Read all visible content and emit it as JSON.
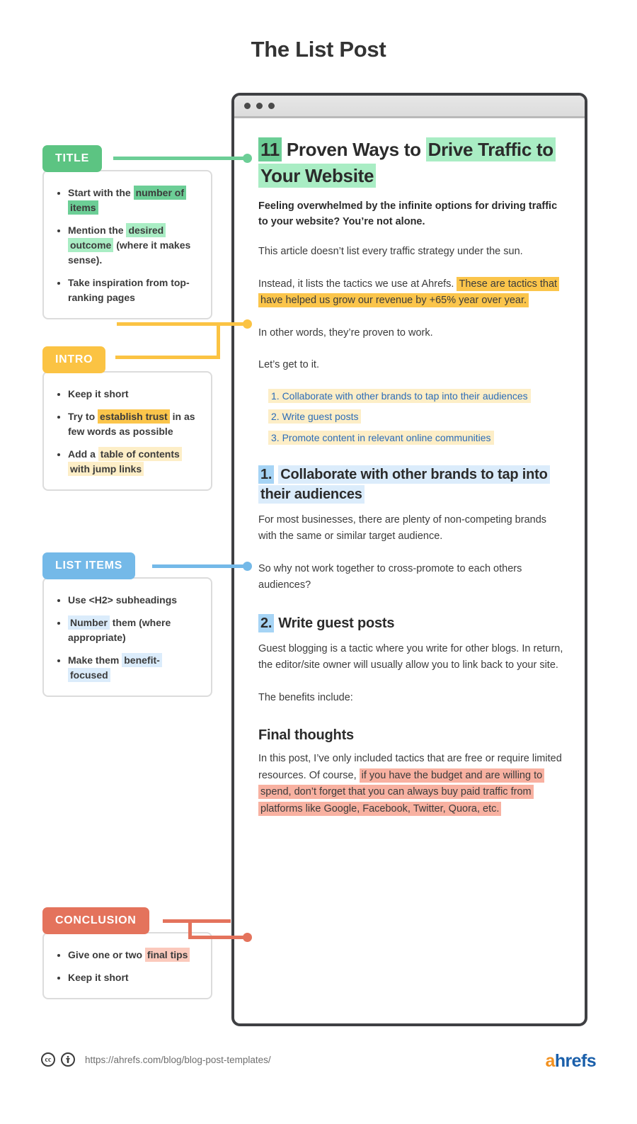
{
  "page": {
    "title": "The List Post"
  },
  "browser": {
    "dots_count": 3
  },
  "article": {
    "h1": {
      "number": "11",
      "mid": " Proven Ways to ",
      "highlight": "Drive Traffic to Your Website"
    },
    "lead": "Feeling overwhelmed by the infinite options for driving traffic to your website? You’re not alone.",
    "p1": "This article doesn’t list every traffic strategy under the sun.",
    "p2_plain": "Instead, it lists the tactics we use at Ahrefs. ",
    "p2_highlight": "These are tactics that have helped us grow our revenue by +65% year over year.",
    "p3": "In other words, they’re proven to work.",
    "p4": "Let’s get to it.",
    "toc": [
      "1. Collaborate with other brands to tap into their audiences",
      "2. Write guest posts",
      "3. Promote content in relevant online communities"
    ],
    "section1": {
      "number": "1.",
      "heading": "Collaborate with other brands to tap into their audiences",
      "p1": "For most businesses, there are plenty of non-competing brands with the same or similar target audience.",
      "p2": "So why not work together to cross-promote to each others audiences?"
    },
    "section2": {
      "number": "2.",
      "heading": "Write guest posts",
      "p1": "Guest blogging is a tactic where you write for other blogs. In return, the editor/site owner will usually allow you to link back to your site.",
      "p2": "The benefits include:"
    },
    "final": {
      "heading": "Final thoughts",
      "plain": "In this post, I’ve only included tactics that are free or require limited resources. Of course, ",
      "highlight": "if you have the budget and are willing to spend, don’t forget that you can always buy paid traffic from platforms like Google, Facebook, Twitter, Quora, etc."
    }
  },
  "cards": [
    {
      "tag": "TITLE",
      "color": "#5cc482",
      "items": [
        {
          "before": "Start with the ",
          "mark": "number of items",
          "after": ""
        },
        {
          "before": "Mention the ",
          "mark": "desired outcome",
          "after": " (where it makes sense)."
        },
        {
          "before": "Take inspiration from top-ranking pages",
          "mark": "",
          "after": ""
        }
      ]
    },
    {
      "tag": "INTRO",
      "color": "#fbc343",
      "items": [
        {
          "before": "Keep it short",
          "mark": "",
          "after": ""
        },
        {
          "before": "Try to ",
          "mark": "establish trust",
          "after": " in as few words as possible"
        },
        {
          "before": "Add a ",
          "mark": "table of contents with jump links",
          "after": ""
        }
      ]
    },
    {
      "tag": "LIST ITEMS",
      "color": "#74b9e8",
      "items": [
        {
          "before": "Use <H2> subheadings",
          "mark": "",
          "after": ""
        },
        {
          "before": "",
          "mark": "Number",
          "after": " them (where appropriate)"
        },
        {
          "before": "Make them ",
          "mark": "benefit-focused",
          "after": ""
        }
      ]
    },
    {
      "tag": "CONCLUSION",
      "color": "#e4735c",
      "items": [
        {
          "before": "Give one or two ",
          "mark": "final tips",
          "after": ""
        },
        {
          "before": "Keep it short",
          "mark": "",
          "after": ""
        }
      ]
    }
  ],
  "footer": {
    "cc_label": "cc",
    "by_label": "ⓘ",
    "url": "https://ahrefs.com/blog/blog-post-templates/",
    "logo_a": "a",
    "logo_rest": "hrefs"
  }
}
